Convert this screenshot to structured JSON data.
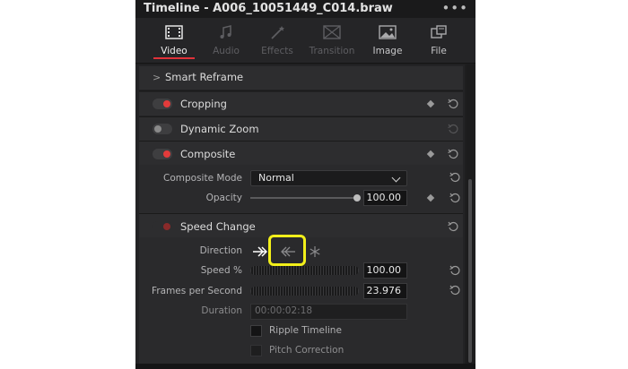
{
  "window": {
    "title": "Timeline - A006_10051449_C014.braw",
    "menu_icon": "more-dots-icon"
  },
  "tabs": [
    {
      "label": "Video",
      "icon": "film-icon",
      "state": "active"
    },
    {
      "label": "Audio",
      "icon": "music-note-icon",
      "state": "disabled"
    },
    {
      "label": "Effects",
      "icon": "magic-wand-icon",
      "state": "disabled"
    },
    {
      "label": "Transition",
      "icon": "transition-icon",
      "state": "disabled"
    },
    {
      "label": "Image",
      "icon": "image-icon",
      "state": "enabled"
    },
    {
      "label": "File",
      "icon": "file-icon",
      "state": "enabled"
    }
  ],
  "sections": {
    "smart_reframe": {
      "title": "Smart Reframe"
    },
    "cropping": {
      "title": "Cropping",
      "enabled": true
    },
    "dynamic_zoom": {
      "title": "Dynamic Zoom",
      "enabled": false
    },
    "composite": {
      "title": "Composite",
      "enabled": true,
      "mode_label": "Composite Mode",
      "mode_value": "Normal",
      "opacity_label": "Opacity",
      "opacity_value": "100.00"
    },
    "speed_change": {
      "title": "Speed Change",
      "enabled": true,
      "direction_label": "Direction",
      "direction_icons": [
        "forward-arrow-icon",
        "reverse-arrow-icon",
        "freeze-frame-icon"
      ],
      "speed_label": "Speed %",
      "speed_value": "100.00",
      "fps_label": "Frames per Second",
      "fps_value": "23.976",
      "duration_label": "Duration",
      "duration_value": "00:00:02:18",
      "ripple_label": "Ripple Timeline",
      "pitch_label": "Pitch Correction"
    }
  },
  "colors": {
    "accent": "#e0323a",
    "highlight": "#f2ef1a",
    "panel_bg": "#232325"
  }
}
